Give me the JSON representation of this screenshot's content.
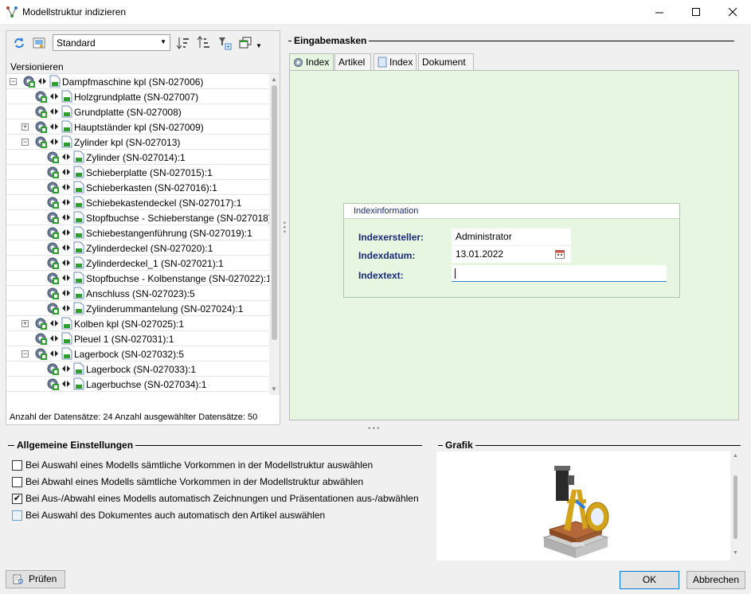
{
  "window": {
    "title": "Modellstruktur indizieren"
  },
  "toolbar": {
    "view_selected": "Standard"
  },
  "tree": {
    "header": "Versionieren",
    "rows": [
      {
        "label": "Dampfmaschine kpl (SN-027006)",
        "level": 0,
        "expander": "minus"
      },
      {
        "label": "Holzgrundplatte (SN-027007)",
        "level": 1,
        "expander": ""
      },
      {
        "label": "Grundplatte (SN-027008)",
        "level": 1,
        "expander": ""
      },
      {
        "label": "Hauptständer kpl (SN-027009)",
        "level": 1,
        "expander": "plus"
      },
      {
        "label": "Zylinder kpl (SN-027013)",
        "level": 1,
        "expander": "minus"
      },
      {
        "label": "Zylinder (SN-027014):1",
        "level": 2,
        "expander": ""
      },
      {
        "label": "Schieberplatte (SN-027015):1",
        "level": 2,
        "expander": ""
      },
      {
        "label": "Schieberkasten (SN-027016):1",
        "level": 2,
        "expander": ""
      },
      {
        "label": "Schiebekastendeckel (SN-027017):1",
        "level": 2,
        "expander": ""
      },
      {
        "label": "Stopfbuchse - Schieberstange (SN-027018)",
        "level": 2,
        "expander": ""
      },
      {
        "label": "Schiebestangenführung (SN-027019):1",
        "level": 2,
        "expander": ""
      },
      {
        "label": "Zylinderdeckel (SN-027020):1",
        "level": 2,
        "expander": ""
      },
      {
        "label": "Zylinderdeckel_1 (SN-027021):1",
        "level": 2,
        "expander": ""
      },
      {
        "label": "Stopfbuchse - Kolbenstange (SN-027022):1",
        "level": 2,
        "expander": ""
      },
      {
        "label": "Anschluss (SN-027023):5",
        "level": 2,
        "expander": ""
      },
      {
        "label": "Zylinderummantelung (SN-027024):1",
        "level": 2,
        "expander": ""
      },
      {
        "label": "Kolben kpl (SN-027025):1",
        "level": 1,
        "expander": "plus"
      },
      {
        "label": "Pleuel 1 (SN-027031):1",
        "level": 1,
        "expander": ""
      },
      {
        "label": "Lagerbock (SN-027032):5",
        "level": 1,
        "expander": "minus"
      },
      {
        "label": "Lagerbock (SN-027033):1",
        "level": 2,
        "expander": ""
      },
      {
        "label": "Lagerbuchse (SN-027034):1",
        "level": 2,
        "expander": ""
      }
    ],
    "status": "Anzahl der Datensätze: 24   Anzahl ausgewählter Datensätze: 50"
  },
  "input_masks": {
    "group_title": "Eingabemasken",
    "tabs": [
      "Index",
      "Artikel",
      "Index",
      "Dokument"
    ],
    "index_box_title": "Indexinformation",
    "fields": {
      "creator_label": "Indexersteller:",
      "creator_value": "Administrator",
      "date_label": "Indexdatum:",
      "date_value": "13.01.2022",
      "text_label": "Indextext:",
      "text_value": ""
    }
  },
  "settings": {
    "group_title": "Allgemeine Einstellungen",
    "options": [
      {
        "label": "Bei Auswahl eines Modells sämtliche Vorkommen in der Modellstruktur auswählen",
        "checked": false
      },
      {
        "label": "Bei Abwahl eines Modells sämtliche Vorkommen in der Modellstruktur abwählen",
        "checked": false
      },
      {
        "label": "Bei Aus-/Abwahl eines Modells automatisch Zeichnungen und Präsentationen aus-/abwählen",
        "checked": true
      },
      {
        "label": "Bei Auswahl des Dokumentes auch automatisch den Artikel auswählen",
        "checked": false
      }
    ]
  },
  "graphic": {
    "group_title": "Grafik"
  },
  "buttons": {
    "check": "Prüfen",
    "ok": "OK",
    "cancel": "Abbrechen"
  },
  "colors": {
    "form_bg": "#e6f6e1",
    "label_blue": "#1a2a7a",
    "tree_icon_green": "#2e9e2e"
  }
}
